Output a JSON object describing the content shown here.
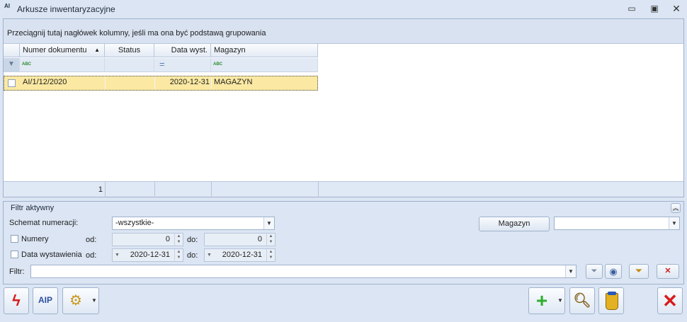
{
  "window": {
    "icon_text": "AI",
    "title": "Arkusze inwentaryzacyjne"
  },
  "grid": {
    "group_hint": "Przeciągnij tutaj nagłówek kolumny, jeśli ma ona być podstawą grupowania",
    "columns": [
      "Numer dokumentu",
      "Status",
      "Data wyst.",
      "Magazyn"
    ],
    "filter_row": {
      "abc": "ABC",
      "eq": "="
    },
    "rows": [
      {
        "numer": "AI/1/12/2020",
        "status": "",
        "data": "2020-12-31",
        "magazyn": "MAGAZYN"
      }
    ],
    "footer_count": "1"
  },
  "filter": {
    "title": "Filtr aktywny",
    "schemat_label": "Schemat numeracji:",
    "schemat_value": "-wszystkie-",
    "magazyn_button": "Magazyn",
    "magazyn_value": "",
    "numery_label": "Numery",
    "od_label": "od:",
    "do_label": "do:",
    "numery_od": "0",
    "numery_do": "0",
    "data_label": "Data wystawienia",
    "data_od": "2020-12-31",
    "data_do": "2020-12-31",
    "filtr_label": "Filtr:",
    "filtr_value": ""
  },
  "colors": {
    "accent_row": "#fbe9a3",
    "panel": "#dbe5f3",
    "close_red": "#d81b1b",
    "add_green": "#2eae2e"
  }
}
